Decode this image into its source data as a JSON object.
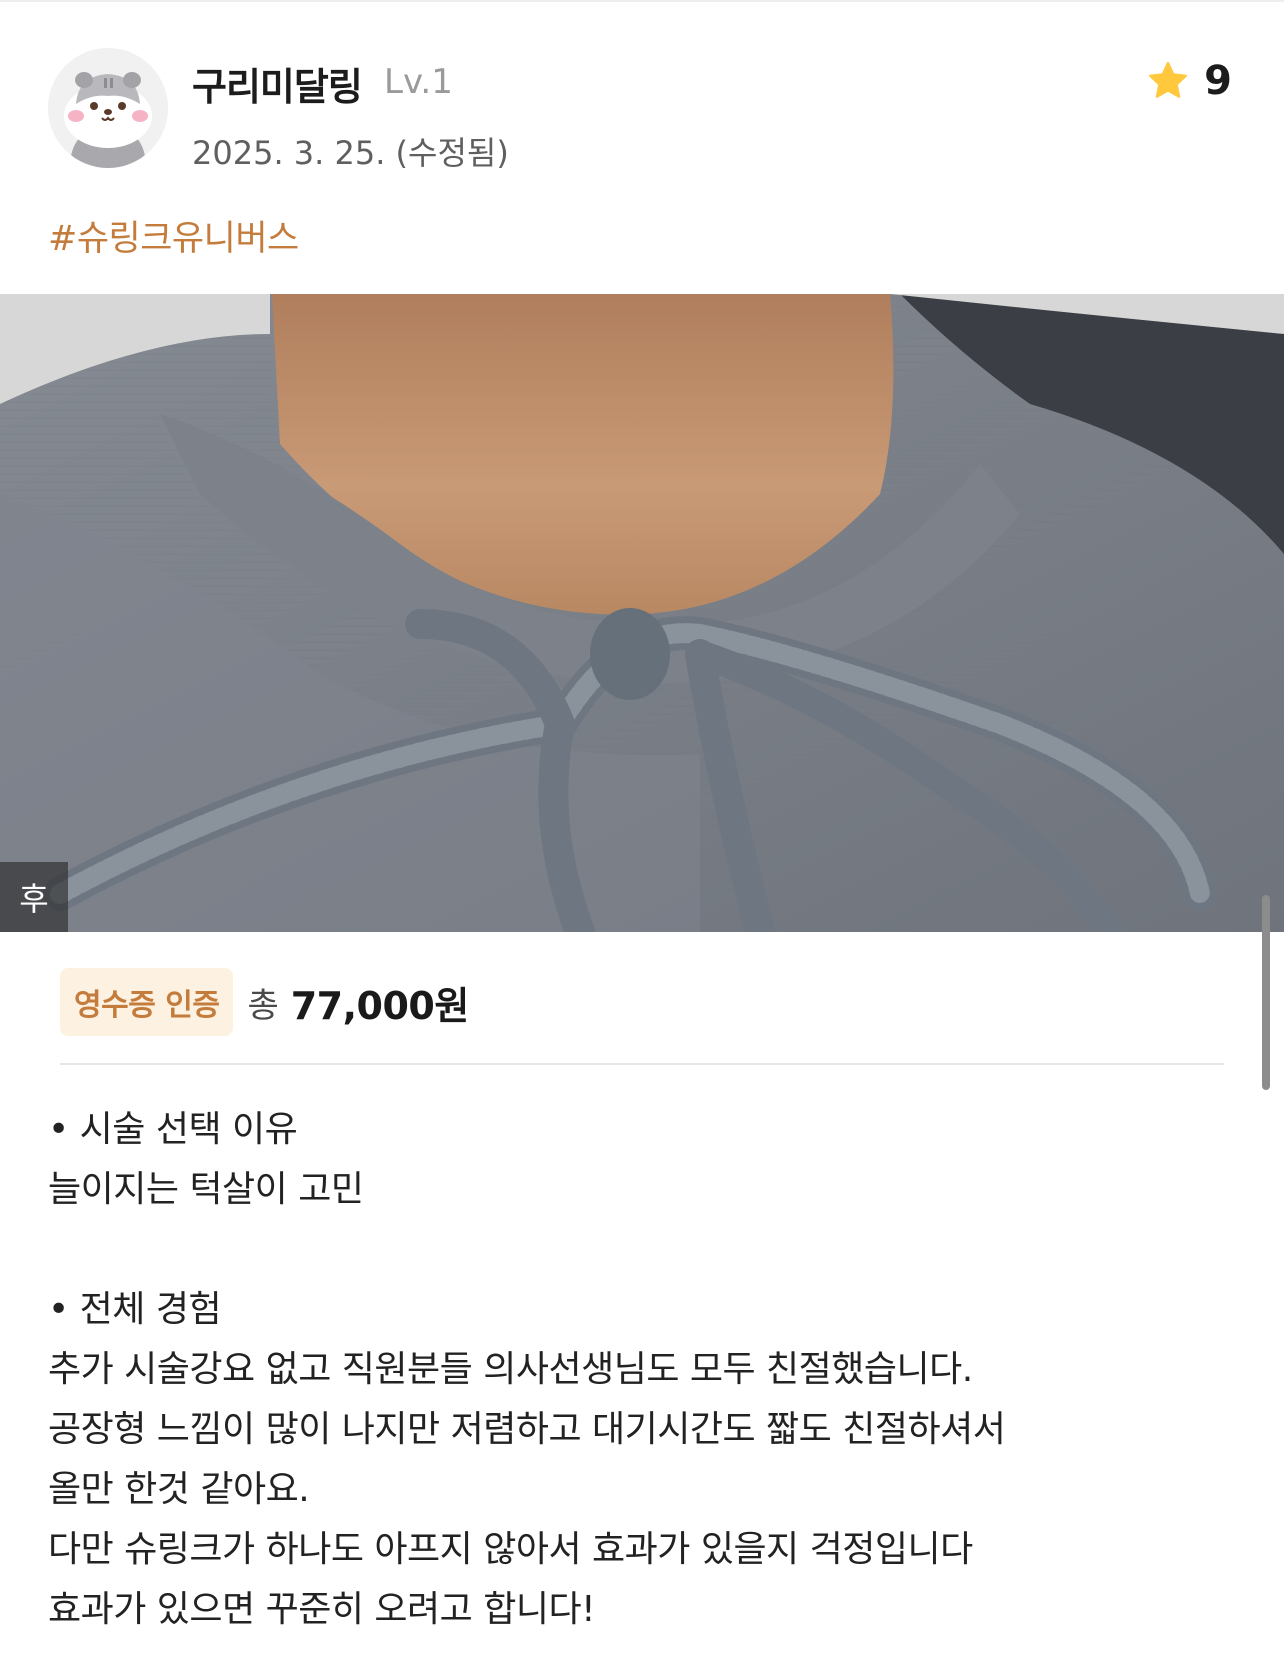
{
  "user": {
    "name": "구리미달링",
    "level": "Lv.1",
    "date": "2025. 3. 25. (수정됨)",
    "avatar": "hamster-avatar"
  },
  "rating": {
    "icon": "star-icon",
    "value": "9",
    "star_color": "#FFC83D"
  },
  "hashtag": "#슈링크유니버스",
  "photo": {
    "badge": "후"
  },
  "receipt": {
    "badge": "영수증 인증",
    "total_label": "총",
    "total_amount": "77,000원",
    "accent": "#C47C3C"
  },
  "review": {
    "section1_title": "• 시술 선택 이유",
    "section1_body": "늘이지는 턱살이 고민",
    "section2_title": "• 전체 경험",
    "section2_lines": [
      "추가 시술강요 없고 직원분들 의사선생님도 모두 친절했습니다.",
      "공장형 느낌이 많이 나지만 저렴하고 대기시간도 짧도 친절하셔서",
      "올만 한것 같아요.",
      "다만 슈링크가 하나도 아프지 않아서 효과가 있을지 걱정입니다",
      "효과가 있으면 꾸준히 오려고 합니다!"
    ]
  }
}
